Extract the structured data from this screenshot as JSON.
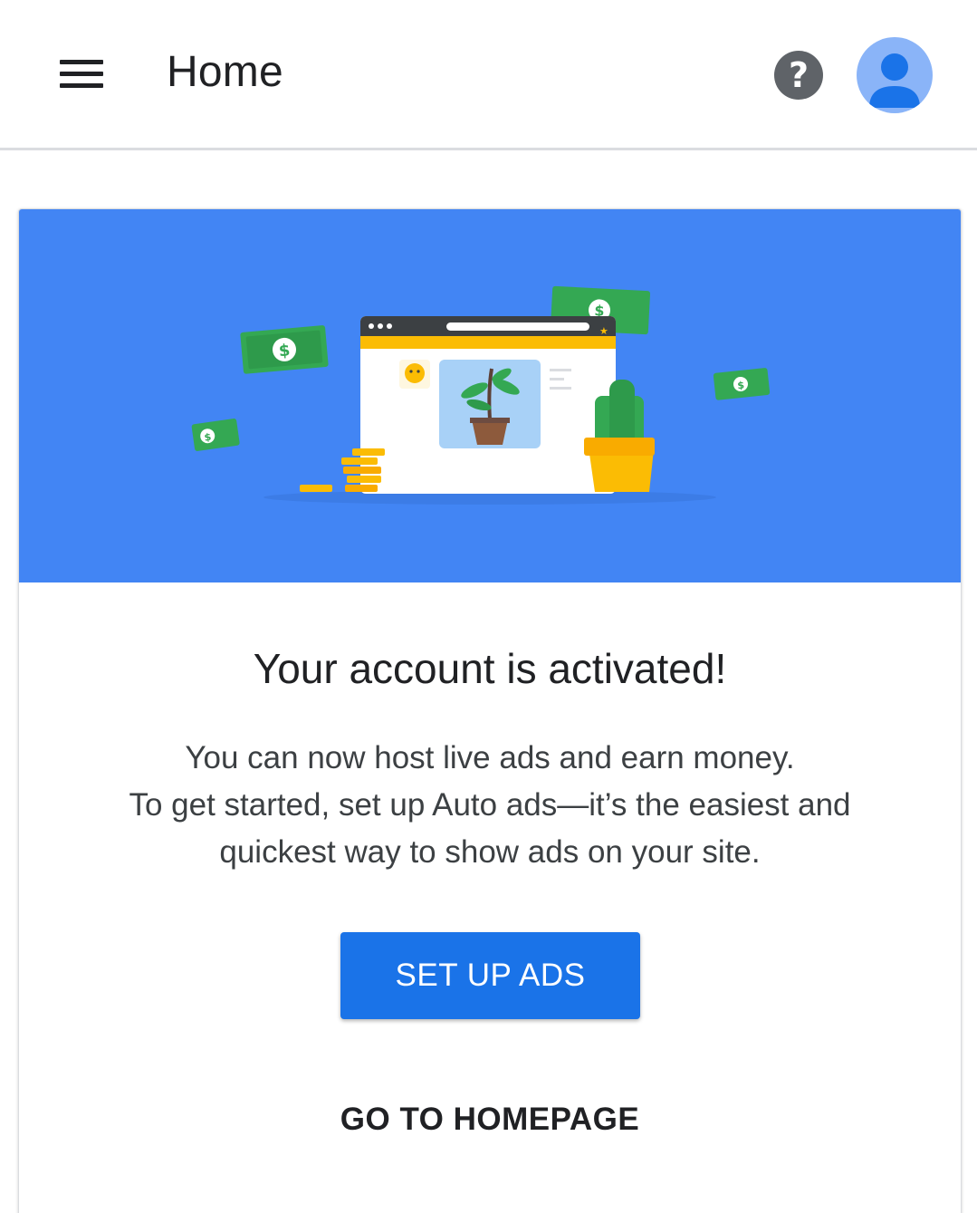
{
  "app_bar": {
    "title": "Home",
    "menu_icon": "hamburger-menu-icon",
    "help_label": "?",
    "help_icon": "help-circle-icon",
    "avatar_icon": "account-circle-icon"
  },
  "card": {
    "illustration": "browser-window-with-plant-and-money-illustration",
    "title": "Your account is activated!",
    "body_lines": [
      "You can now host live ads and earn money.",
      "To get started, set up Auto ads—it’s the easiest and",
      "quickest way to show ads on your site."
    ],
    "primary_button": "SET UP ADS",
    "secondary_button": "GO TO HOMEPAGE"
  },
  "colors": {
    "accent": "#1a73e8",
    "hero_background": "#4285f4",
    "avatar_background": "#8ab4f8",
    "money_green": "#34a853",
    "coin_yellow": "#fbbc04"
  }
}
